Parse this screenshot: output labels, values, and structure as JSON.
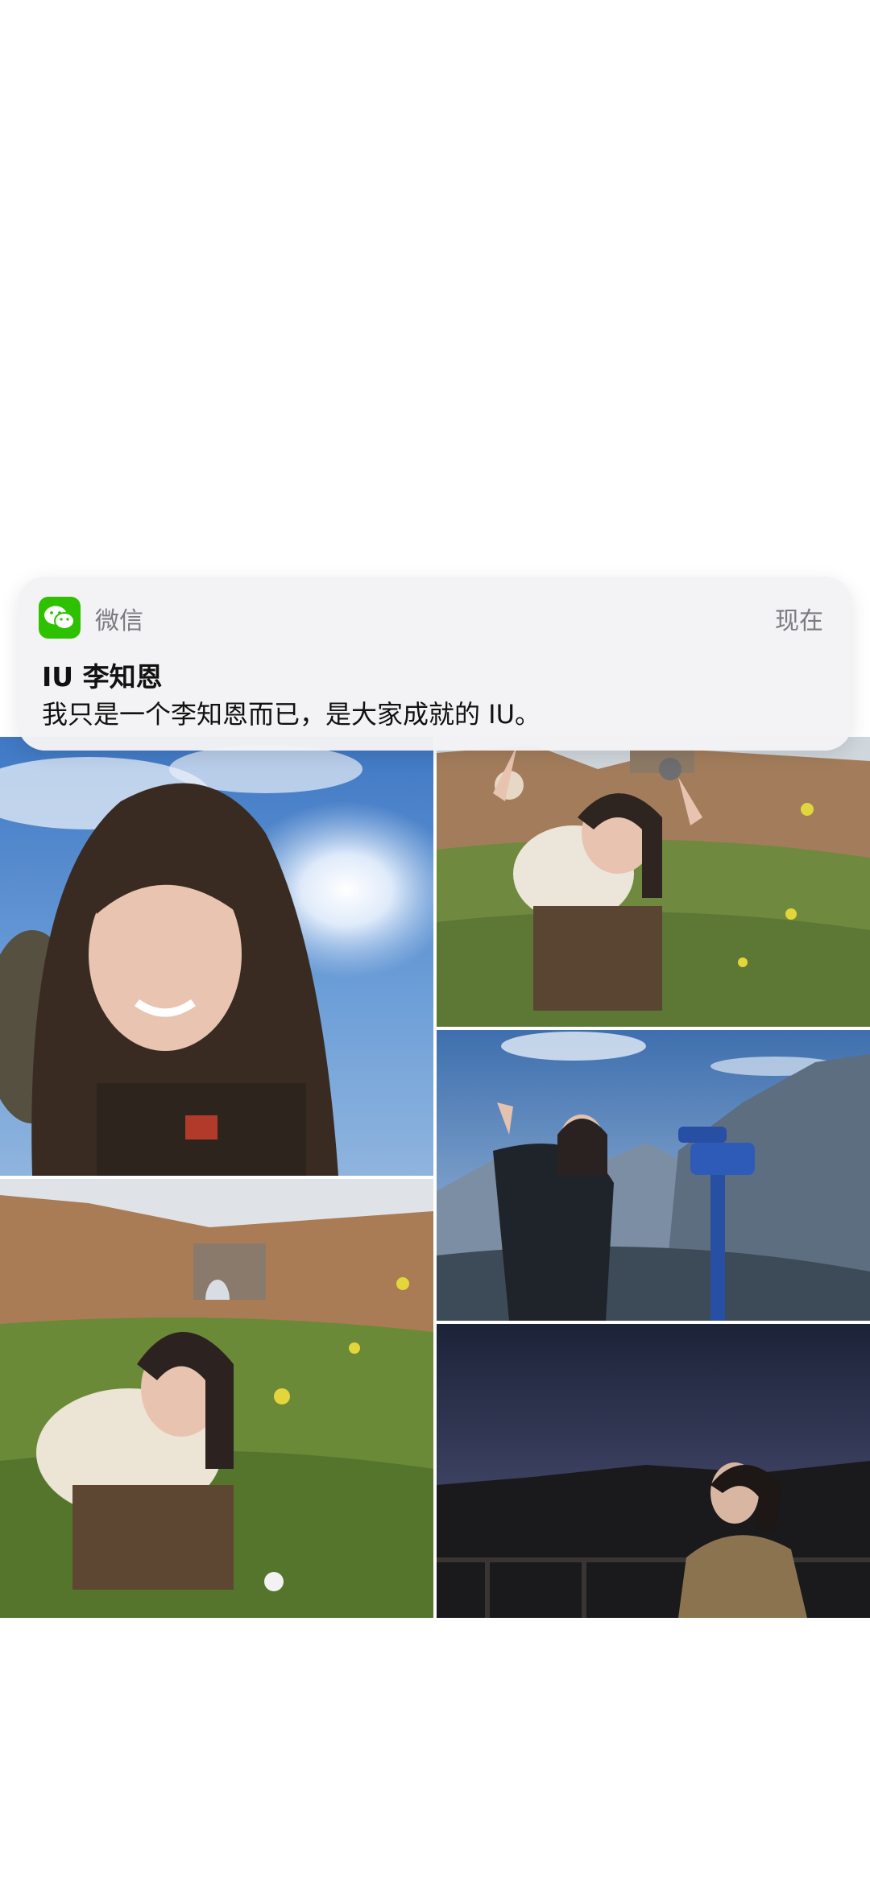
{
  "notification": {
    "app_name": "微信",
    "app_icon": "wechat-icon",
    "time": "现在",
    "title": "IU 李知恩",
    "message": "我只是一个李知恩而已，是大家成就的 IU。"
  },
  "colors": {
    "wechat_green": "#2dc100",
    "notification_bg": "#f3f3f5",
    "sky_blue": "#4f8bd0"
  }
}
